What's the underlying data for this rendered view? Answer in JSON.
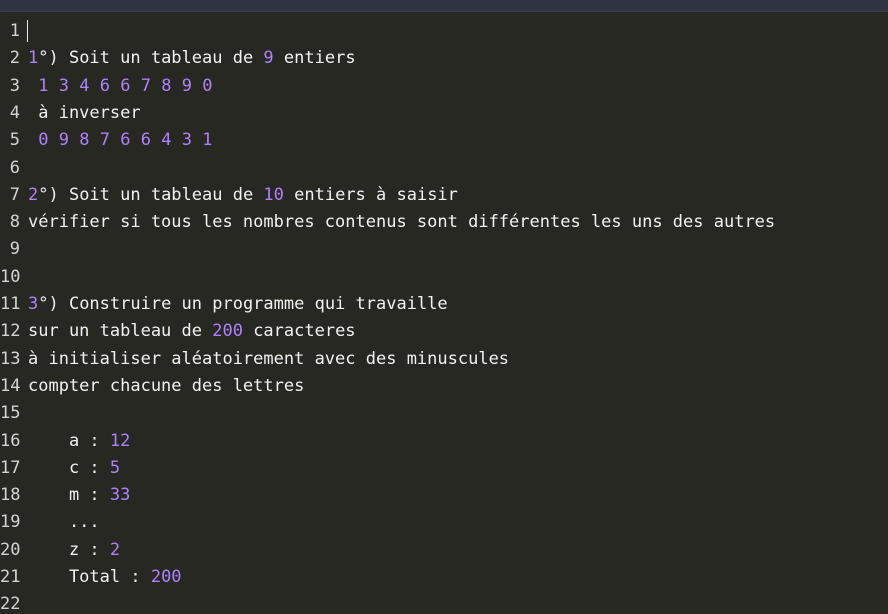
{
  "editor": {
    "lines": [
      {
        "n": "1",
        "code": ""
      },
      {
        "n": "2",
        "code": "[1]°) Soit un tableau de [9] entiers"
      },
      {
        "n": "3",
        "code": " [1] [3] [4] [6] [6] [7] [8] [9] [0]"
      },
      {
        "n": "4",
        "code": " à inverser"
      },
      {
        "n": "5",
        "code": " [0] [9] [8] [7] [6] [6] [4] [3] [1]"
      },
      {
        "n": "6",
        "code": ""
      },
      {
        "n": "7",
        "code": "[2]°) Soit un tableau de [10] entiers à saisir"
      },
      {
        "n": "8",
        "code": "vérifier si tous les nombres contenus sont différentes les uns des autres"
      },
      {
        "n": "9",
        "code": ""
      },
      {
        "n": "10",
        "code": ""
      },
      {
        "n": "11",
        "code": "[3]°) Construire un programme qui travaille"
      },
      {
        "n": "12",
        "code": "sur un tableau de [200] caracteres"
      },
      {
        "n": "13",
        "code": "à initialiser aléatoirement avec des minuscules"
      },
      {
        "n": "14",
        "code": "compter chacune des lettres"
      },
      {
        "n": "15",
        "code": ""
      },
      {
        "n": "16",
        "code": "    a : [12]"
      },
      {
        "n": "17",
        "code": "    c : [5]"
      },
      {
        "n": "18",
        "code": "    m : [33]"
      },
      {
        "n": "19",
        "code": "    ..."
      },
      {
        "n": "20",
        "code": "    z : [2]"
      },
      {
        "n": "21",
        "code": "    Total : [200]"
      },
      {
        "n": "22",
        "code": ""
      }
    ]
  },
  "colors": {
    "background": "#272822",
    "text": "#f2f2f2",
    "number": "#ae81ff",
    "gutter": "#d4d4d4"
  }
}
